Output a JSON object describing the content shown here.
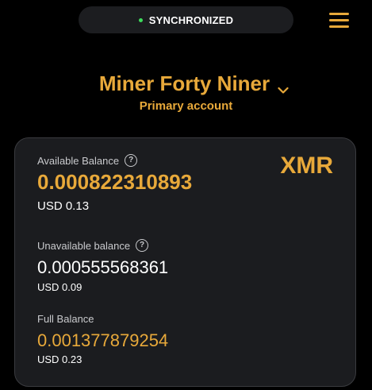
{
  "status": {
    "label": "SYNCHRONIZED",
    "dot_color": "#3ddc5c"
  },
  "menu": {
    "icon": "hamburger-menu-icon"
  },
  "account": {
    "name": "Miner Forty Niner",
    "subtitle": "Primary account",
    "dropdown_icon": "chevron-down-icon"
  },
  "balances": {
    "currency": "XMR",
    "available": {
      "label": "Available Balance",
      "amount": "0.000822310893",
      "fiat": "USD 0.13"
    },
    "unavailable": {
      "label": "Unavailable balance",
      "amount": "0.000555568361",
      "fiat": "USD 0.09"
    },
    "full": {
      "label": "Full Balance",
      "amount": "0.001377879254",
      "fiat": "USD 0.23"
    },
    "help_icon": "?"
  },
  "colors": {
    "accent": "#e8a93a",
    "background": "#000000",
    "card": "#1b1c1f"
  }
}
